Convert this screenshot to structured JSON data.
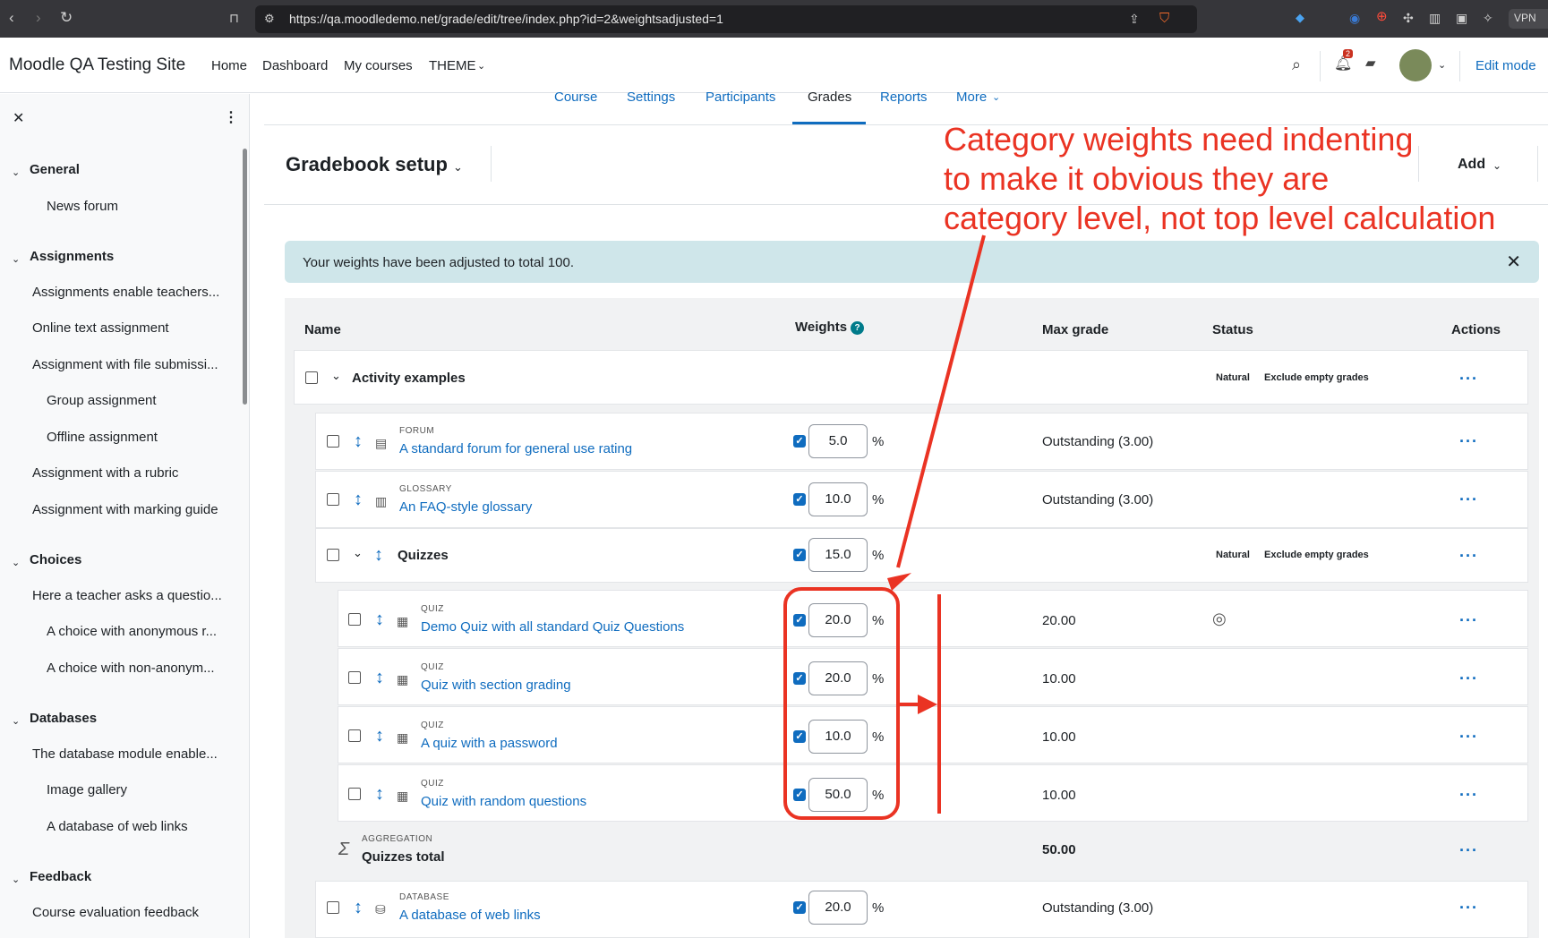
{
  "browser": {
    "url": "https://qa.moodledemo.net/grade/edit/tree/index.php?id=2&weightsadjusted=1",
    "vpn": "VPN",
    "notif_count": "2"
  },
  "navbar": {
    "site_name": "Moodle QA Testing Site",
    "links": [
      "Home",
      "Dashboard",
      "My courses",
      "THEME"
    ],
    "edit_mode": "Edit mode"
  },
  "sidebar": {
    "sections": [
      {
        "title": "General",
        "items": [
          "News forum"
        ]
      },
      {
        "title": "Assignments",
        "items": [
          "Assignments enable teachers...",
          "Online text assignment",
          "Assignment with file submissi...",
          "Group assignment",
          "Offline assignment",
          "Assignment with a rubric",
          "Assignment with marking guide"
        ]
      },
      {
        "title": "Choices",
        "items": [
          "Here a teacher asks a questio...",
          "A choice with anonymous r...",
          "A choice with non-anonym..."
        ]
      },
      {
        "title": "Databases",
        "items": [
          "The database module enable...",
          "Image gallery",
          "A database of web links"
        ]
      },
      {
        "title": "Feedback",
        "items": [
          "Course evaluation feedback"
        ]
      }
    ]
  },
  "tabs": [
    "Course",
    "Settings",
    "Participants",
    "Grades",
    "Reports",
    "More"
  ],
  "page_title": "Gradebook setup",
  "add_label": "Add",
  "alert": "Your weights have been adjusted to total 100.",
  "table": {
    "headers": {
      "name": "Name",
      "weights": "Weights",
      "max_grade": "Max grade",
      "status": "Status",
      "actions": "Actions"
    },
    "category_activity": {
      "name": "Activity examples",
      "badges": [
        "Natural",
        "Exclude empty grades"
      ]
    },
    "items": [
      {
        "type": "FORUM",
        "name": "A standard forum for general use rating",
        "weight": "5.0",
        "max": "Outstanding (3.00)"
      },
      {
        "type": "GLOSSARY",
        "name": "An FAQ-style glossary",
        "weight": "10.0",
        "max": "Outstanding (3.00)"
      }
    ],
    "category_quizzes": {
      "name": "Quizzes",
      "weight": "15.0",
      "badges": [
        "Natural",
        "Exclude empty grades"
      ]
    },
    "quizzes": [
      {
        "type": "QUIZ",
        "name": "Demo Quiz with all standard Quiz Questions",
        "weight": "20.0",
        "max": "20.00"
      },
      {
        "type": "QUIZ",
        "name": "Quiz with section grading",
        "weight": "20.0",
        "max": "10.00"
      },
      {
        "type": "QUIZ",
        "name": "A quiz with a password",
        "weight": "10.0",
        "max": "10.00"
      },
      {
        "type": "QUIZ",
        "name": "Quiz with random questions",
        "weight": "50.0",
        "max": "10.00"
      }
    ],
    "quizzes_total": {
      "type": "AGGREGATION",
      "name": "Quizzes total",
      "max": "50.00"
    },
    "database_item": {
      "type": "DATABASE",
      "name": "A database of web links",
      "weight": "20.0",
      "max": "Outstanding (3.00)"
    },
    "pct": "%"
  },
  "annotation": [
    "Category weights need indenting",
    "to make it obvious they are",
    "category level, not top level calculation"
  ],
  "colors": {
    "annotation": "#ea3323",
    "link": "#0f6cbf",
    "alert_bg": "#cfe6ea"
  }
}
